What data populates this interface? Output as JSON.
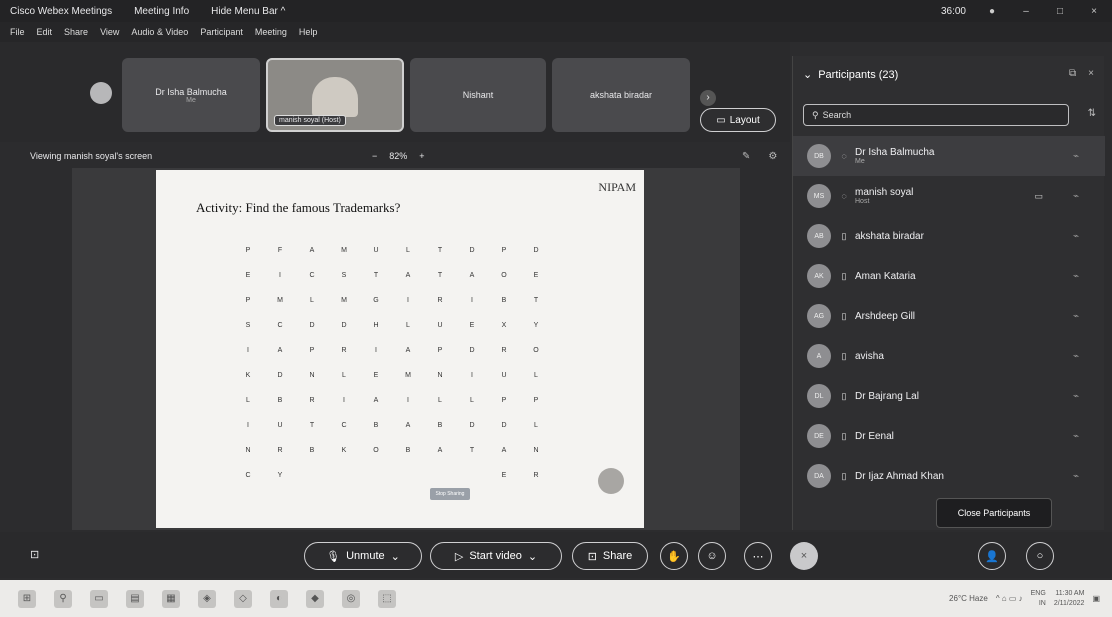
{
  "titlebar": {
    "app_title": "Cisco Webex Meetings",
    "meeting_info": "Meeting Info",
    "hide_menu": "Hide Menu Bar ^",
    "time": "36:00"
  },
  "menu": [
    "File",
    "Edit",
    "Share",
    "View",
    "Audio & Video",
    "Participant",
    "Meeting",
    "Help"
  ],
  "strip": {
    "tiles": [
      {
        "name": "Dr Isha Balmucha",
        "sub": "Me"
      },
      {
        "name": "manish soyal (Host)",
        "sub": ""
      },
      {
        "name": "Nishant",
        "sub": ""
      },
      {
        "name": "akshata biradar",
        "sub": ""
      }
    ],
    "layout_label": "Layout"
  },
  "viewbar": {
    "label": "Viewing manish soyal's screen",
    "zoom_minus": "−",
    "zoom": "82%",
    "zoom_plus": "+"
  },
  "slide": {
    "logo": "NIPAM",
    "title": "Activity: Find the famous Trademarks?",
    "grid": [
      [
        "P",
        "F",
        "A",
        "M",
        "U",
        "L",
        "T",
        "D",
        "P",
        "D"
      ],
      [
        "E",
        "I",
        "C",
        "S",
        "T",
        "A",
        "T",
        "A",
        "O",
        "E"
      ],
      [
        "P",
        "M",
        "L",
        "M",
        "G",
        "I",
        "R",
        "I",
        "B",
        "T"
      ],
      [
        "S",
        "C",
        "D",
        "D",
        "H",
        "L",
        "U",
        "E",
        "X",
        "Y"
      ],
      [
        "I",
        "A",
        "P",
        "R",
        "I",
        "A",
        "P",
        "D",
        "R",
        "O"
      ],
      [
        "K",
        "D",
        "N",
        "L",
        "E",
        "M",
        "N",
        "I",
        "U",
        "L"
      ],
      [
        "L",
        "B",
        "R",
        "I",
        "A",
        "I",
        "L",
        "L",
        "P",
        "P"
      ],
      [
        "I",
        "U",
        "T",
        "C",
        "B",
        "A",
        "B",
        "D",
        "D",
        "L"
      ],
      [
        "N",
        "R",
        "B",
        "K",
        "O",
        "B",
        "A",
        "T",
        "A",
        "N"
      ],
      [
        "C",
        "Y",
        "",
        "",
        "",
        "",
        "",
        "",
        "E",
        "R"
      ]
    ],
    "button_label": "Stop Sharing"
  },
  "participants": {
    "header": "Participants (23)",
    "search_placeholder": "Search",
    "tooltip": "Close Participants",
    "list": [
      {
        "initials": "DB",
        "name": "Dr Isha Balmucha",
        "role": "Me"
      },
      {
        "initials": "MS",
        "name": "manish soyal",
        "role": "Host"
      },
      {
        "initials": "AB",
        "name": "akshata biradar",
        "role": ""
      },
      {
        "initials": "AK",
        "name": "Aman Kataria",
        "role": ""
      },
      {
        "initials": "AG",
        "name": "Arshdeep Gill",
        "role": ""
      },
      {
        "initials": "A",
        "name": "avisha",
        "role": ""
      },
      {
        "initials": "DL",
        "name": "Dr Bajrang Lal",
        "role": ""
      },
      {
        "initials": "DE",
        "name": "Dr Eenal",
        "role": ""
      },
      {
        "initials": "DA",
        "name": "Dr Ijaz Ahmad Khan",
        "role": ""
      }
    ]
  },
  "controls": {
    "unmute": "Unmute",
    "start_video": "Start video",
    "share": "Share"
  },
  "taskbar": {
    "weather": "26°C Haze",
    "lang": "ENG",
    "lang2": "IN",
    "clock_time": "11:30 AM",
    "clock_date": "2/11/2022"
  }
}
